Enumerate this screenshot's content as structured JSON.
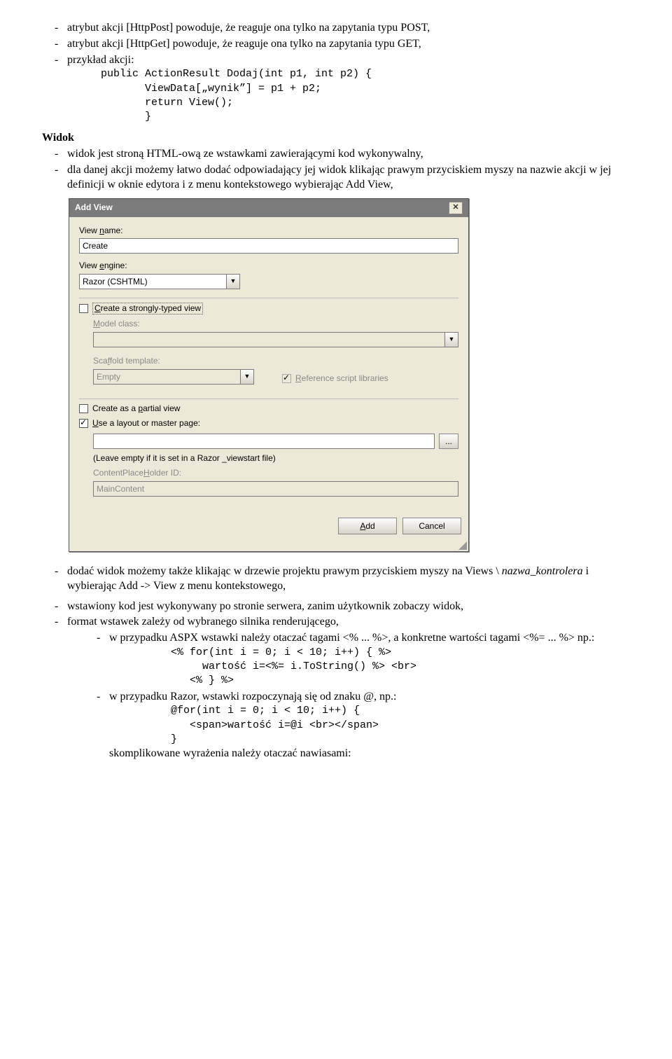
{
  "top_bullets": [
    "atrybut akcji [HttpPost] powoduje, że reaguje ona tylko na zapytania typu POST,",
    "atrybut akcji [HttpGet] powoduje, że reaguje ona tylko na zapytania typu GET,",
    "przykład akcji:"
  ],
  "top_code": "public ActionResult Dodaj(int p1, int p2) {\n       ViewData[„wynik”] = p1 + p2;\n       return View();\n       }",
  "section_heading": "Widok",
  "mid_bullets": [
    "widok jest stroną HTML-ową ze wstawkami zawierającymi kod wykonywalny,",
    "dla danej akcji możemy łatwo dodać odpowiadający jej widok klikając prawym przyciskiem myszy na nazwie akcji w jej definicji w oknie edytora i z menu kontekstowego wybierając Add View,"
  ],
  "dialog": {
    "title": "Add View",
    "view_name_label": "View name:",
    "view_name_value": "Create",
    "view_engine_label": "View engine:",
    "view_engine_value": "Razor (CSHTML)",
    "check_strongly": "Create a strongly-typed view",
    "model_class_label": "Model class:",
    "scaffold_label": "Scaffold template:",
    "scaffold_value": "Empty",
    "check_reference": "Reference script libraries",
    "check_partial": "Create as a partial view",
    "check_layout": "Use a layout or master page:",
    "layout_hint": "(Leave empty if it is set in a Razor _viewstart file)",
    "cph_label": "ContentPlaceHolder ID:",
    "cph_value": "MainContent",
    "btn_add": "Add",
    "btn_cancel": "Cancel"
  },
  "post_bullets": [
    {
      "pre": "dodać widok możemy także klikając w drzewie projektu prawym przyciskiem myszy na Views \\ ",
      "it": "nazwa_kontrolera",
      "post": " i wybierając Add -> View z menu kontekstowego,"
    },
    {
      "pre": "wstawiony kod jest wykonywany po stronie serwera, zanim użytkownik zobaczy widok,",
      "it": "",
      "post": ""
    },
    {
      "pre": "format wstawek zależy od wybranego silnika renderującego,",
      "it": "",
      "post": ""
    }
  ],
  "sub_bullets": {
    "aspx_text": "w przypadku ASPX wstawki należy otaczać tagami <% ... %>, a konkretne wartości tagami <%= ... %> np.:",
    "aspx_code": "<% for(int i = 0; i < 10; i++) { %>\n     wartość i=<%= i.ToString() %> <br>\n   <% } %>",
    "razor_text": "w przypadku Razor, wstawki rozpoczynają się od znaku @, np.:",
    "razor_code": "@for(int i = 0; i < 10; i++) {\n   <span>wartość i=@i <br></span>\n}",
    "razor_tail": "skomplikowane wyrażenia należy otaczać nawiasami:"
  }
}
